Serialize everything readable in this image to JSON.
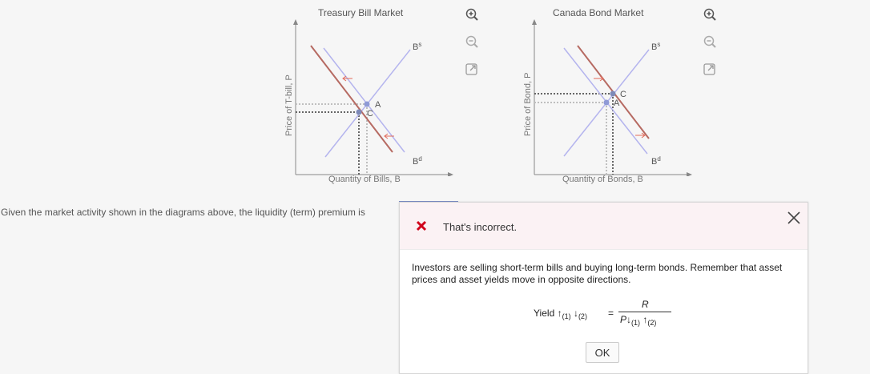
{
  "diagrams": [
    {
      "title": "Treasury Bill Market",
      "x_axis": "Quantity of Bills, B",
      "y_axis": "Price of T-bill, P",
      "labels": {
        "supply": "B",
        "supply_sup": "s",
        "demand": "B",
        "demand_sup": "d",
        "point_a": "A",
        "point_c": "C"
      }
    },
    {
      "title": "Canada Bond Market",
      "x_axis": "Quantity of Bonds, B",
      "y_axis": "Price of Bond, P",
      "labels": {
        "supply": "B",
        "supply_sup": "s",
        "demand": "B",
        "demand_sup": "d",
        "point_a": "A",
        "point_c": "C"
      }
    }
  ],
  "toolbar": {
    "icons": [
      "zoom-in-icon",
      "zoom-out-icon",
      "open-external-icon"
    ]
  },
  "question": {
    "text": "Given the market activity shown in the diagrams above, the liquidity (term) premium is"
  },
  "feedback": {
    "status": "That's incorrect.",
    "message": "Investors are selling short-term bills and buying long-term bonds. Remember that asset prices and asset yields move in opposite directions.",
    "formula": {
      "lhs": "Yield",
      "sub1": "(1)",
      "sub2": "(2)",
      "equals": "=",
      "numerator": "R",
      "denominator": "P",
      "dsub1": "(1)",
      "dsub2": "(2)"
    },
    "ok_label": "OK"
  },
  "colors": {
    "background": "#f6f6f6",
    "curve_blue": "#b4b4ee",
    "curve_red": "#b66a62",
    "point": "#7e8ab8",
    "error_red": "#d0021b",
    "feedback_header": "#fbf2f4"
  }
}
